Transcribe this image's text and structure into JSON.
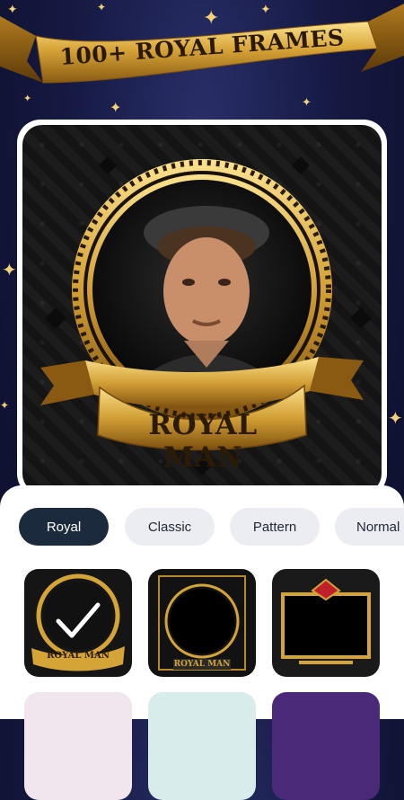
{
  "header": {
    "banner_title": "100+ ROYAL FRAMES"
  },
  "preview": {
    "ribbon_text": "ROYAL MAN"
  },
  "categories": [
    {
      "label": "Royal",
      "selected": true
    },
    {
      "label": "Classic",
      "selected": false
    },
    {
      "label": "Pattern",
      "selected": false
    },
    {
      "label": "Normal",
      "selected": false
    }
  ],
  "frames": [
    {
      "caption": "ROYAL MAN",
      "selected": true
    },
    {
      "caption": "ROYAL MAN",
      "selected": false
    },
    {
      "caption": "",
      "selected": false
    }
  ],
  "colors": {
    "gold": "#d4a437",
    "navy_background": "#161a44",
    "chip_active": "#1c2a3d",
    "chip_inactive": "#ebedf2"
  }
}
